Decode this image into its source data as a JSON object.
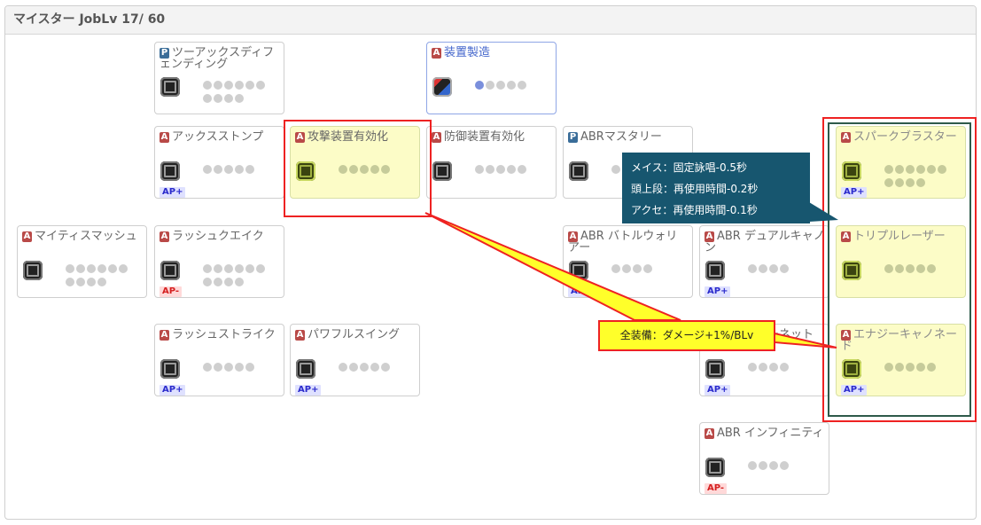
{
  "header": {
    "title": "マイスター JobLv 17/ 60"
  },
  "cards": [
    {
      "type": "P",
      "name": "ツーアックスディフェンディング",
      "dots": 10,
      "on": 0,
      "ap": ""
    },
    {
      "type": "A",
      "name": "装置製造",
      "dots": 5,
      "on": 1,
      "ap": ""
    },
    {
      "type": "A",
      "name": "アックスストンプ",
      "dots": 5,
      "on": 0,
      "ap": "AP+"
    },
    {
      "type": "A",
      "name": "攻撃装置有効化",
      "dots": 5,
      "on": 0,
      "ap": ""
    },
    {
      "type": "A",
      "name": "防御装置有効化",
      "dots": 5,
      "on": 0,
      "ap": ""
    },
    {
      "type": "P",
      "name": "ABRマスタリー",
      "dots": 5,
      "on": 0,
      "ap": ""
    },
    {
      "type": "A",
      "name": "スパークブラスター",
      "dots": 10,
      "on": 0,
      "ap": "AP+"
    },
    {
      "type": "A",
      "name": "マイティスマッシュ",
      "dots": 10,
      "on": 0,
      "ap": ""
    },
    {
      "type": "A",
      "name": "ラッシュクエイク",
      "dots": 10,
      "on": 0,
      "ap": "AP-"
    },
    {
      "type": "A",
      "name": "ABR バトルウォリアー",
      "dots": 4,
      "on": 0,
      "ap": "AP+"
    },
    {
      "type": "A",
      "name": "ABR デュアルキャノン",
      "dots": 4,
      "on": 0,
      "ap": "AP+"
    },
    {
      "type": "A",
      "name": "トリプルレーザー",
      "dots": 5,
      "on": 0,
      "ap": ""
    },
    {
      "type": "A",
      "name": "ラッシュストライク",
      "dots": 5,
      "on": 0,
      "ap": "AP+"
    },
    {
      "type": "A",
      "name": "パワフルスイング",
      "dots": 5,
      "on": 0,
      "ap": "AP+"
    },
    {
      "type": "A",
      "name": "ABR マザーネット",
      "dots": 4,
      "on": 0,
      "ap": "AP+"
    },
    {
      "type": "A",
      "name": "エナジーキャノネード",
      "dots": 5,
      "on": 0,
      "ap": "AP+"
    },
    {
      "type": "A",
      "name": "ABR インフィニティ",
      "dots": 4,
      "on": 0,
      "ap": "AP-"
    }
  ],
  "tooltip": {
    "lines": [
      "メイス：固定詠唱-0.5秒",
      "頭上段：再使用時間-0.2秒",
      "アクセ：再使用時間-0.1秒"
    ]
  },
  "callout": {
    "text": "全装備：ダメージ+1%/BLv"
  }
}
